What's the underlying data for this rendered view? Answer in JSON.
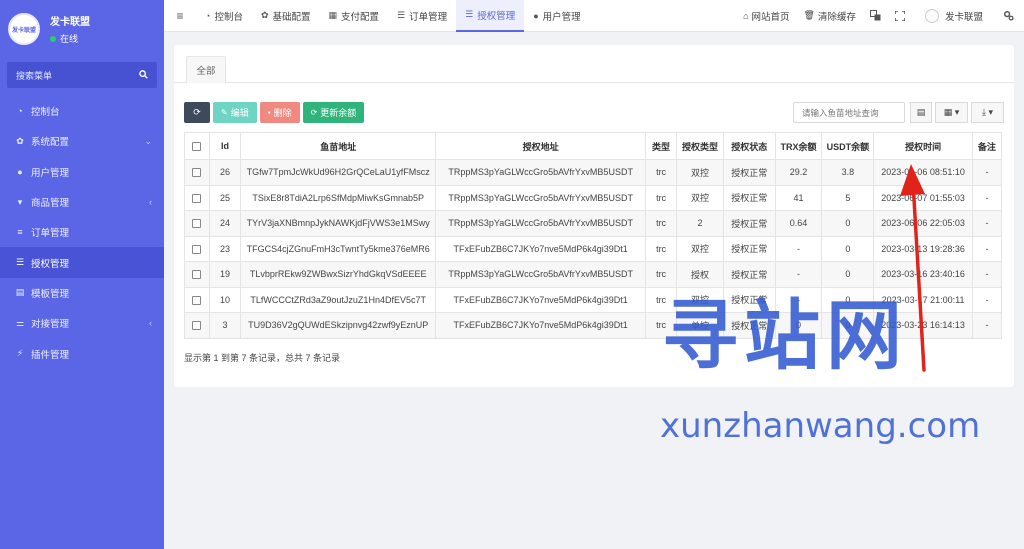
{
  "sidebar": {
    "avatar_text": "发卡联盟",
    "username": "发卡联盟",
    "status": "在线",
    "search_placeholder": "搜索菜单",
    "items": [
      {
        "label": "控制台",
        "icon": "dashboard-icon",
        "glyph": "◔"
      },
      {
        "label": "系统配置",
        "icon": "gear-icon",
        "glyph": "✿",
        "caret": "⌄"
      },
      {
        "label": "用户管理",
        "icon": "user-icon",
        "glyph": "●"
      },
      {
        "label": "商品管理",
        "icon": "cart-icon",
        "glyph": "▾",
        "caret": "‹"
      },
      {
        "label": "订单管理",
        "icon": "list-icon",
        "glyph": "≡"
      },
      {
        "label": "授权管理",
        "icon": "menu-icon",
        "glyph": "☰",
        "active": true
      },
      {
        "label": "模板管理",
        "icon": "template-icon",
        "glyph": "▤"
      },
      {
        "label": "对接管理",
        "icon": "sliders-icon",
        "glyph": "⚌",
        "caret": "‹"
      },
      {
        "label": "插件管理",
        "icon": "plug-icon",
        "glyph": "⚡"
      }
    ]
  },
  "topnav": {
    "tabs": [
      {
        "label": "控制台",
        "icon": "dashboard-icon",
        "glyph": "◔"
      },
      {
        "label": "基础配置",
        "icon": "gear-icon",
        "glyph": "✿"
      },
      {
        "label": "支付配置",
        "icon": "table-icon",
        "glyph": "▦"
      },
      {
        "label": "订单管理",
        "icon": "list-icon",
        "glyph": "☰"
      },
      {
        "label": "授权管理",
        "icon": "menu-icon",
        "glyph": "☰",
        "active": true
      },
      {
        "label": "用户管理",
        "icon": "user-icon",
        "glyph": "●"
      }
    ],
    "home_label": "网站首页",
    "clear_cache_label": "清除缓存",
    "username": "发卡联盟"
  },
  "panel": {
    "tab_all": "全部",
    "buttons": {
      "edit": "编辑",
      "delete": "删除",
      "update": "更新余额"
    },
    "search_placeholder": "请输入鱼苗地址查询"
  },
  "table": {
    "headers": [
      "Id",
      "鱼苗地址",
      "授权地址",
      "类型",
      "授权类型",
      "授权状态",
      "TRX余额",
      "USDT余额",
      "授权时间",
      "备注"
    ],
    "rows": [
      [
        "26",
        "TGfw7TpmJcWkUd96H2GrQCeLaU1yfFMscz",
        "TRppMS3pYaGLWccGro5bAVfrYxvMB5USDT",
        "trc",
        "双控",
        "授权正常",
        "29.2",
        "3.8",
        "2023-06-06 08:51:10",
        "-"
      ],
      [
        "25",
        "TSixE8r8TdiA2Lrp6SfMdpMiwKsGmnab5P",
        "TRppMS3pYaGLWccGro5bAVfrYxvMB5USDT",
        "trc",
        "双控",
        "授权正常",
        "41",
        "5",
        "2023-06-07 01:55:03",
        "-"
      ],
      [
        "24",
        "TYrV3jaXNBmnpJykNAWKjdFjVWS3e1MSwy",
        "TRppMS3pYaGLWccGro5bAVfrYxvMB5USDT",
        "trc",
        "2",
        "授权正常",
        "0.64",
        "0",
        "2023-06-06 22:05:03",
        "-"
      ],
      [
        "23",
        "TFGCS4cjZGnuFmH3cTwntTy5kme376eMR6",
        "TFxEFubZB6C7JKYo7nve5MdP6k4gi39Dt1",
        "trc",
        "双控",
        "授权正常",
        "-",
        "0",
        "2023-03-13 19:28:36",
        "-"
      ],
      [
        "19",
        "TLvbprREkw9ZWBwxSizrYhdGkqVSdEEEE",
        "TRppMS3pYaGLWccGro5bAVfrYxvMB5USDT",
        "trc",
        "授权",
        "授权正常",
        "-",
        "0",
        "2023-03-16 23:40:16",
        "-"
      ],
      [
        "10",
        "TLfWCCCtZRd3aZ9outJzuZ1Hn4DfEV5c7T",
        "TFxEFubZB6C7JKYo7nve5MdP6k4gi39Dt1",
        "trc",
        "双控",
        "授权正常",
        "-",
        "0",
        "2023-03-17 21:00:11",
        "-"
      ],
      [
        "3",
        "TU9D36V2gQUWdESkzipnvg42zwf9yEznUP",
        "TFxEFubZB6C7JKYo7nve5MdP6k4gi39Dt1",
        "trc",
        "单控",
        "授权正常",
        "0",
        "0",
        "2023-03-23 16:14:13",
        "-"
      ]
    ]
  },
  "pager_text": "显示第 1 到第 7 条记录，总共 7 条记录",
  "watermark": {
    "text": "寻站网",
    "url": "xunzhanwang.com"
  },
  "colors": {
    "sidebar": "#5b66e6",
    "accent": "#5b66e6",
    "arrow": "#e0241b"
  }
}
